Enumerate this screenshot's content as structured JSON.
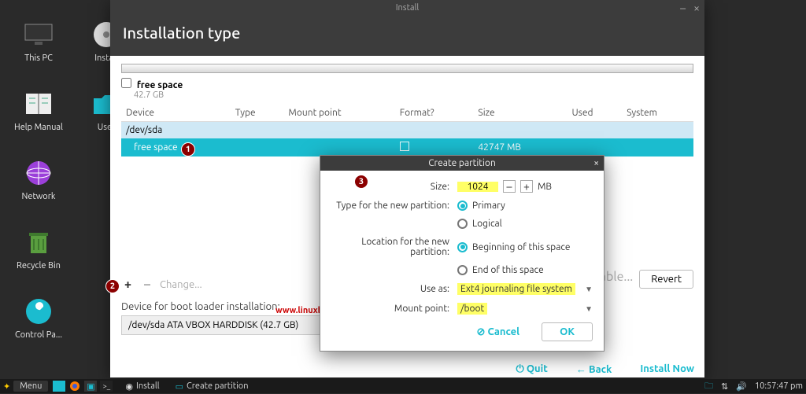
{
  "desktop": {
    "icons": [
      {
        "label": "This PC"
      },
      {
        "label": "Install"
      },
      {
        "label": "Help Manual"
      },
      {
        "label": "User"
      },
      {
        "label": "Network"
      },
      {
        "label": "Recycle Bin"
      },
      {
        "label": "Control Pa..."
      }
    ]
  },
  "install_window": {
    "title": "Install",
    "heading": "Installation type",
    "free_space_label": "free space",
    "free_space_size": "42.7 GB",
    "columns": {
      "device": "Device",
      "type": "Type",
      "mount": "Mount point",
      "format": "Format?",
      "size": "Size",
      "used": "Used",
      "system": "System"
    },
    "rows": {
      "sda": {
        "device": "/dev/sda"
      },
      "free": {
        "device": "free space",
        "size": "42747 MB"
      }
    },
    "toolbar": {
      "plus": "+",
      "minus": "–",
      "change": "Change...",
      "table": "Table...",
      "revert": "Revert"
    },
    "bootloader": {
      "label": "Device for boot loader installation:",
      "value": "/dev/sda ATA VBOX HARDDISK (42.7 GB)"
    },
    "bottom": {
      "quit": "Quit",
      "back": "Back",
      "install": "Install Now"
    }
  },
  "dialog": {
    "title": "Create partition",
    "size_label": "Size:",
    "size_value": "1024",
    "size_unit": "MB",
    "type_label": "Type for the new partition:",
    "type_primary": "Primary",
    "type_logical": "Logical",
    "loc_label": "Location for the new partition:",
    "loc_begin": "Beginning of this space",
    "loc_end": "End of this space",
    "use_as_label": "Use as:",
    "use_as_value": "Ext4 journaling file system",
    "mount_label": "Mount point:",
    "mount_value": "/boot",
    "cancel": "Cancel",
    "ok": "OK"
  },
  "watermark": "www.linuxbuzz.com",
  "annotations": {
    "a1": "1",
    "a2": "2",
    "a3": "3"
  },
  "taskbar": {
    "menu": "Menu",
    "tasks": [
      {
        "label": "Install"
      },
      {
        "label": "Create partition"
      }
    ],
    "clock": "10:57:47 pm"
  }
}
